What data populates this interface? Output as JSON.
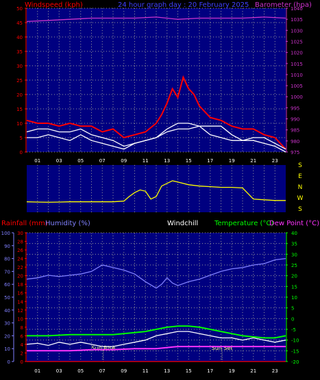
{
  "colors": {
    "background": "#000000",
    "plot_fill": "#000080",
    "grid": "#9a9a9a",
    "wind_speed": "#ff0000",
    "wind_avg": "#ffffff",
    "wind_gust_line": "#00cc00",
    "barometer": "#cc33cc",
    "wind_dir": "#ffff00",
    "humidity": "#8080ff",
    "temperature": "#00ff00",
    "dew_point": "#ff33ff",
    "windchill": "#ffffff",
    "rainfall": "#ff0000",
    "sun_marker": "#ffff80"
  },
  "chart_data": [
    {
      "type": "line",
      "title": "24 hour graph day : 20 February 2025",
      "xlabel": "",
      "x_ticks": [
        "01",
        "03",
        "05",
        "07",
        "09",
        "11",
        "13",
        "15",
        "17",
        "19",
        "21",
        "23"
      ],
      "xlim": [
        0,
        24
      ],
      "left_axis": {
        "label": "Windspeed (kph)",
        "ticks": [
          "0",
          "5",
          "10",
          "15",
          "20",
          "25",
          "30",
          "35",
          "40",
          "45",
          "50"
        ],
        "ylim": [
          0,
          50
        ]
      },
      "right_axis": {
        "label": "Barometer (hpa)",
        "ticks": [
          "975",
          "980",
          "985",
          "990",
          "995",
          "1000",
          "1005",
          "1010",
          "1015",
          "1020",
          "1025",
          "1030",
          "1035",
          "1040"
        ],
        "ylim": [
          975,
          1040
        ]
      },
      "series": [
        {
          "role": "wind_speed",
          "axis": "left",
          "x": [
            0,
            1,
            2,
            3,
            4,
            5,
            6,
            7,
            8,
            9,
            10,
            11,
            12,
            12.5,
            13,
            13.5,
            14,
            14.5,
            15,
            15.5,
            16,
            17,
            18,
            19,
            20,
            21,
            22,
            23,
            23.5,
            24
          ],
          "y": [
            11,
            10,
            10,
            9,
            10,
            9,
            9,
            7,
            8,
            5,
            6,
            7,
            10,
            13,
            17,
            22,
            19,
            26,
            22,
            20,
            16,
            12,
            11,
            9,
            8,
            8,
            6,
            5,
            3,
            1
          ]
        },
        {
          "role": "wind_avg",
          "axis": "left",
          "x": [
            0,
            1,
            2,
            3,
            4,
            5,
            6,
            7,
            8,
            9,
            10,
            11,
            12,
            13,
            14,
            15,
            16,
            17,
            18,
            19,
            20,
            21,
            22,
            23,
            24
          ],
          "y": [
            5,
            5,
            6,
            5,
            4,
            6,
            4,
            3,
            2,
            1,
            3,
            4,
            5,
            7,
            8,
            8,
            9,
            6,
            5,
            4,
            4,
            4,
            3,
            2,
            0
          ]
        },
        {
          "role": "wind_trend",
          "axis": "left",
          "x": [
            0,
            1,
            2,
            3,
            4,
            5,
            6,
            7,
            8,
            9,
            10,
            11,
            12,
            13,
            14,
            15,
            16,
            17,
            18,
            19,
            20,
            21,
            22,
            23,
            24
          ],
          "y": [
            7,
            8,
            8,
            7,
            7,
            8,
            6,
            5,
            4,
            2,
            3,
            4,
            5,
            8,
            10,
            10,
            9,
            9,
            9,
            6,
            4,
            5,
            5,
            3,
            1
          ]
        },
        {
          "role": "barometer",
          "axis": "right",
          "x": [
            0,
            2,
            4,
            6,
            8,
            10,
            12,
            14,
            16,
            18,
            20,
            22,
            24
          ],
          "y": [
            1034,
            1034.5,
            1035,
            1035.5,
            1035.5,
            1035.5,
            1036,
            1035,
            1035.5,
            1035.5,
            1035.5,
            1036,
            1035.5
          ]
        }
      ]
    },
    {
      "type": "line",
      "xlim": [
        0,
        24
      ],
      "direction_labels": [
        "S",
        "E",
        "N",
        "W",
        "S"
      ],
      "series": [
        {
          "role": "wind_dir",
          "x": [
            0,
            1,
            2,
            3,
            4,
            5,
            6,
            7,
            8,
            9,
            9.5,
            10,
            10.5,
            11,
            11.5,
            12,
            12.5,
            13,
            13.5,
            14,
            15,
            16,
            17,
            18,
            19,
            20,
            21,
            22,
            23,
            24
          ],
          "y": [
            80,
            78,
            76,
            78,
            80,
            80,
            80,
            80,
            80,
            85,
            120,
            150,
            170,
            160,
            100,
            120,
            200,
            220,
            240,
            230,
            210,
            200,
            195,
            190,
            190,
            185,
            100,
            95,
            90,
            90
          ]
        }
      ]
    },
    {
      "type": "line",
      "xlim": [
        0,
        24
      ],
      "x_ticks": [
        "01",
        "03",
        "05",
        "07",
        "09",
        "11",
        "13",
        "15",
        "17",
        "19",
        "21",
        "23"
      ],
      "legend": [
        "Rainfall (mm)",
        "Humidity (%)",
        "Windchill",
        "Temperature (°C)",
        "Dew Point (°C)"
      ],
      "axis_humidity": {
        "ticks": [
          "0",
          "10",
          "20",
          "30",
          "40",
          "50",
          "60",
          "70",
          "80",
          "90",
          "100"
        ],
        "ylim": [
          0,
          100
        ]
      },
      "axis_rain": {
        "ticks": [
          "0",
          "2",
          "4",
          "6",
          "8",
          "10",
          "12",
          "14",
          "16",
          "18",
          "20",
          "22",
          "24",
          "26",
          "28",
          "30"
        ],
        "ylim": [
          0,
          30
        ]
      },
      "axis_temp": {
        "ticks": [
          "-20",
          "-15",
          "-10",
          "-5",
          "0",
          "5",
          "10",
          "15",
          "20",
          "25",
          "30",
          "35",
          "40"
        ],
        "ylim": [
          -20,
          40
        ]
      },
      "annotations": [
        {
          "label": "Sun Rise",
          "x": 7.1
        },
        {
          "label": "Sun Set",
          "x": 18.1
        }
      ],
      "series": [
        {
          "role": "humidity",
          "axis": "humidity",
          "x": [
            0,
            1,
            2,
            3,
            4,
            5,
            6,
            7,
            8,
            9,
            10,
            11,
            12,
            12.5,
            13,
            13.5,
            14,
            15,
            16,
            17,
            18,
            19,
            20,
            21,
            22,
            23,
            24
          ],
          "y": [
            64,
            65,
            67,
            66,
            67,
            68,
            70,
            75,
            73,
            71,
            68,
            62,
            57,
            60,
            65,
            61,
            59,
            62,
            64,
            67,
            70,
            72,
            73,
            75,
            76,
            79,
            80
          ]
        },
        {
          "role": "temperature",
          "axis": "temp",
          "x": [
            0,
            2,
            4,
            6,
            8,
            10,
            11,
            12,
            13,
            14,
            15,
            16,
            17,
            18,
            19,
            20,
            21,
            22,
            23,
            24
          ],
          "y": [
            -8,
            -8,
            -7.5,
            -7.5,
            -7.5,
            -6.5,
            -6,
            -5,
            -4,
            -3.5,
            -3.5,
            -4,
            -5,
            -6,
            -7,
            -8,
            -8.5,
            -9,
            -9,
            -8
          ]
        },
        {
          "role": "windchill",
          "axis": "temp",
          "x": [
            0,
            1,
            2,
            3,
            4,
            5,
            6,
            7,
            8,
            9,
            10,
            11,
            12,
            13,
            14,
            15,
            16,
            17,
            18,
            19,
            20,
            21,
            22,
            23,
            24
          ],
          "y": [
            -12,
            -11.5,
            -12.5,
            -11,
            -12,
            -11,
            -12,
            -13,
            -13,
            -12,
            -11,
            -10,
            -8,
            -7,
            -6,
            -6,
            -7,
            -8,
            -9,
            -9,
            -10,
            -9,
            -10,
            -11,
            -10
          ]
        },
        {
          "role": "dew_point",
          "axis": "temp",
          "x": [
            0,
            2,
            4,
            6,
            8,
            10,
            12,
            13,
            14,
            15,
            16,
            17,
            18,
            20,
            22,
            24
          ],
          "y": [
            -15,
            -15,
            -15,
            -14.5,
            -14.5,
            -14,
            -14,
            -13.5,
            -13,
            -13,
            -13,
            -13,
            -13,
            -13,
            -13,
            -13
          ]
        },
        {
          "role": "rainfall",
          "axis": "rain",
          "x": [
            0,
            24
          ],
          "y": [
            0,
            0
          ]
        }
      ]
    }
  ]
}
